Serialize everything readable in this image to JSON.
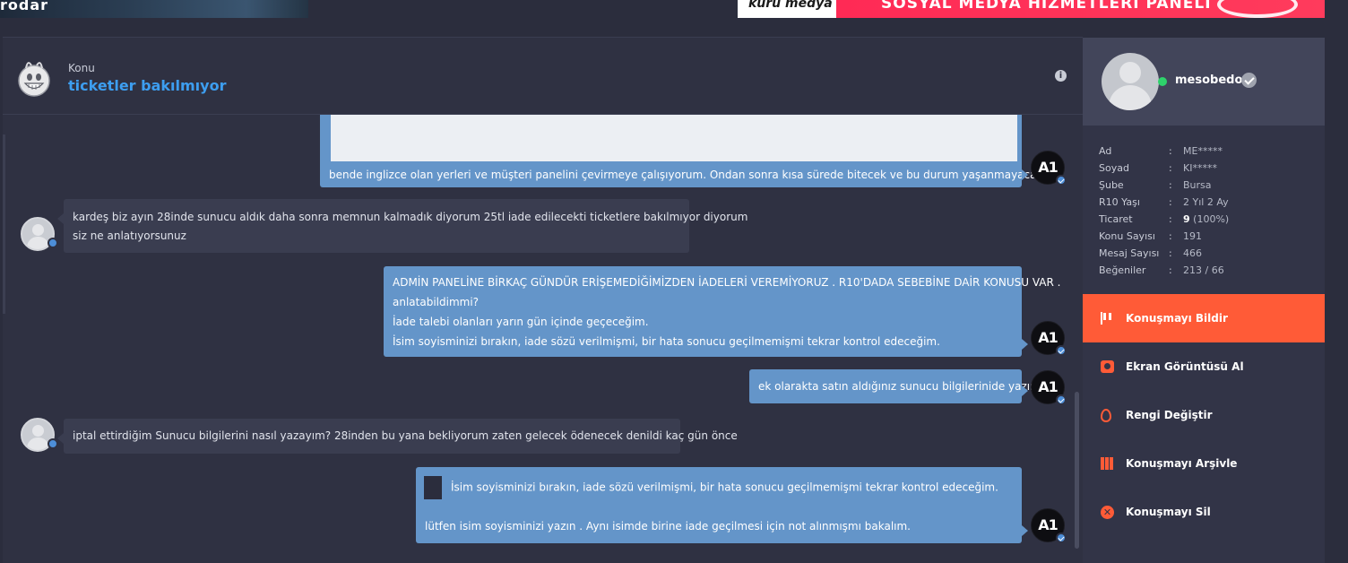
{
  "banners": {
    "left_text": "rodar",
    "right_logo": "kuru medya",
    "right_text": "SOSYAL MEDYA HİZMETLERİ PANELİ"
  },
  "header": {
    "label": "Konu",
    "title": "ticketler bakılmıyor",
    "info_icon": "i"
  },
  "messages": [
    {
      "side": "out",
      "lines": [
        "bende inglizce olan yerleri ve müşteri panelini çevirmeye çalışıyorum. Ondan sonra kısa sürede bitecek ve bu durum yaşanmayacak ."
      ]
    },
    {
      "side": "in",
      "lines": [
        "kardeş biz ayın 28inde sunucu aldık daha sonra memnun kalmadık diyorum 25tl iade edilecekti ticketlere bakılmıyor diyorum",
        "siz ne anlatıyorsunuz"
      ]
    },
    {
      "side": "out",
      "lines": [
        "ADMİN PANELİNE BİRKAÇ GÜNDÜR ERİŞEMEDİĞİMİZDEN İADELERİ VEREMİYORUZ . R10'DADA SEBEBİNE DAİR KONUSU VAR .",
        "anlatabildimmi?",
        "İade talebi olanları yarın gün içinde geçeceğim.",
        "İsim soyisminizi bırakın, iade sözü verilmişmi, bir hata sonucu geçilmemişmi tekrar kontrol edeceğim."
      ]
    },
    {
      "side": "out",
      "lines": [
        "ek olarakta satın aldığınız sunucu bilgilerinide yazın ."
      ]
    },
    {
      "side": "in",
      "lines": [
        "iptal ettirdiğim Sunucu bilgilerini nasıl yazayım? 28inden bu yana bekliyorum zaten gelecek ödenecek denildi kaç gün önce"
      ]
    },
    {
      "side": "out",
      "quote": "İsim soyisminizi bırakın, iade sözü verilmişmi, bir hata sonucu geçilmemişmi tekrar kontrol edeceğim.",
      "lines": [
        "lütfen isim soyisminizi yazın . Aynı isimde birine iade geçilmesi için not alınmışmı bakalım."
      ]
    }
  ],
  "staff_avatar_text": "A1",
  "sidebar": {
    "username": "mesobedo",
    "info": [
      {
        "key": "Ad",
        "value": "ME*****"
      },
      {
        "key": "Soyad",
        "value": "KI*****"
      },
      {
        "key": "Şube",
        "value": "Bursa"
      },
      {
        "key": "R10 Yaşı",
        "value": "2 Yıl 2 Ay"
      },
      {
        "key": "Ticaret",
        "value_bold": "9",
        "value": " (100%)"
      },
      {
        "key": "Konu Sayısı",
        "value": "191"
      },
      {
        "key": "Mesaj Sayısı",
        "value": "466"
      },
      {
        "key": "Beğeniler",
        "value": "213 / 66"
      }
    ],
    "actions": [
      {
        "label": "Konuşmayı Bildir",
        "icon": "flag-icon",
        "active": true
      },
      {
        "label": "Ekran Görüntüsü Al",
        "icon": "camera-icon",
        "active": false
      },
      {
        "label": "Rengi Değiştir",
        "icon": "drop-icon",
        "active": false
      },
      {
        "label": "Konuşmayı Arşivle",
        "icon": "archive-icon",
        "active": false
      },
      {
        "label": "Konuşmayı Sil",
        "icon": "delete-icon",
        "active": false
      }
    ]
  },
  "colors": {
    "accent": "#ff5b37",
    "link": "#3d9ef0",
    "bubble_out": "#6495c9",
    "bubble_in": "#3a3d50"
  }
}
